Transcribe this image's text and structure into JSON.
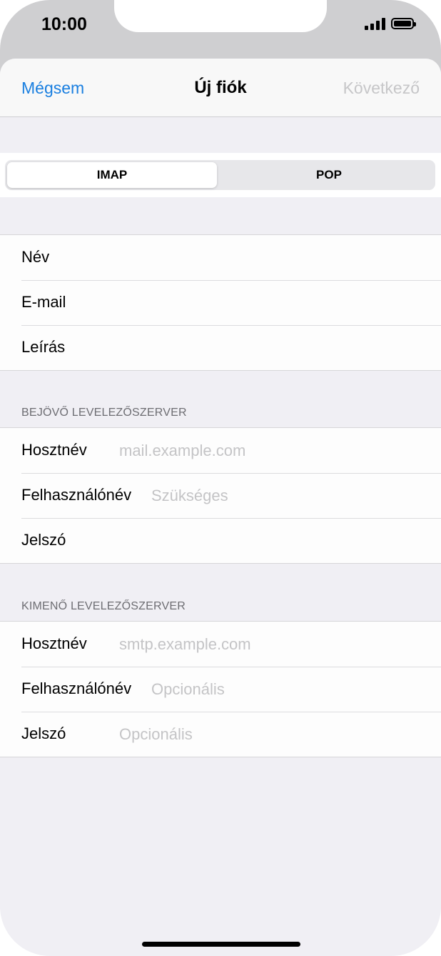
{
  "status_bar": {
    "time": "10:00"
  },
  "nav": {
    "cancel": "Mégsem",
    "title": "Új fiók",
    "next": "Következő"
  },
  "segment": {
    "options": [
      "IMAP",
      "POP"
    ],
    "selected": "IMAP"
  },
  "account": {
    "rows": [
      {
        "label": "Név",
        "placeholder": ""
      },
      {
        "label": "E-mail",
        "placeholder": ""
      },
      {
        "label": "Leírás",
        "placeholder": ""
      }
    ]
  },
  "incoming": {
    "header": "BEJÖVŐ LEVELEZŐSZERVER",
    "rows": [
      {
        "label": "Hosztnév",
        "placeholder": "mail.example.com"
      },
      {
        "label": "Felhasználónév",
        "placeholder": "Szükséges"
      },
      {
        "label": "Jelszó",
        "placeholder": ""
      }
    ]
  },
  "outgoing": {
    "header": "KIMENŐ LEVELEZŐSZERVER",
    "rows": [
      {
        "label": "Hosztnév",
        "placeholder": "smtp.example.com"
      },
      {
        "label": "Felhasználónév",
        "placeholder": "Opcionális"
      },
      {
        "label": "Jelszó",
        "placeholder": "Opcionális"
      }
    ]
  },
  "colors": {
    "accent": "#1a7fe0",
    "disabled": "#c6c6c8",
    "background": "#f0eff4"
  }
}
